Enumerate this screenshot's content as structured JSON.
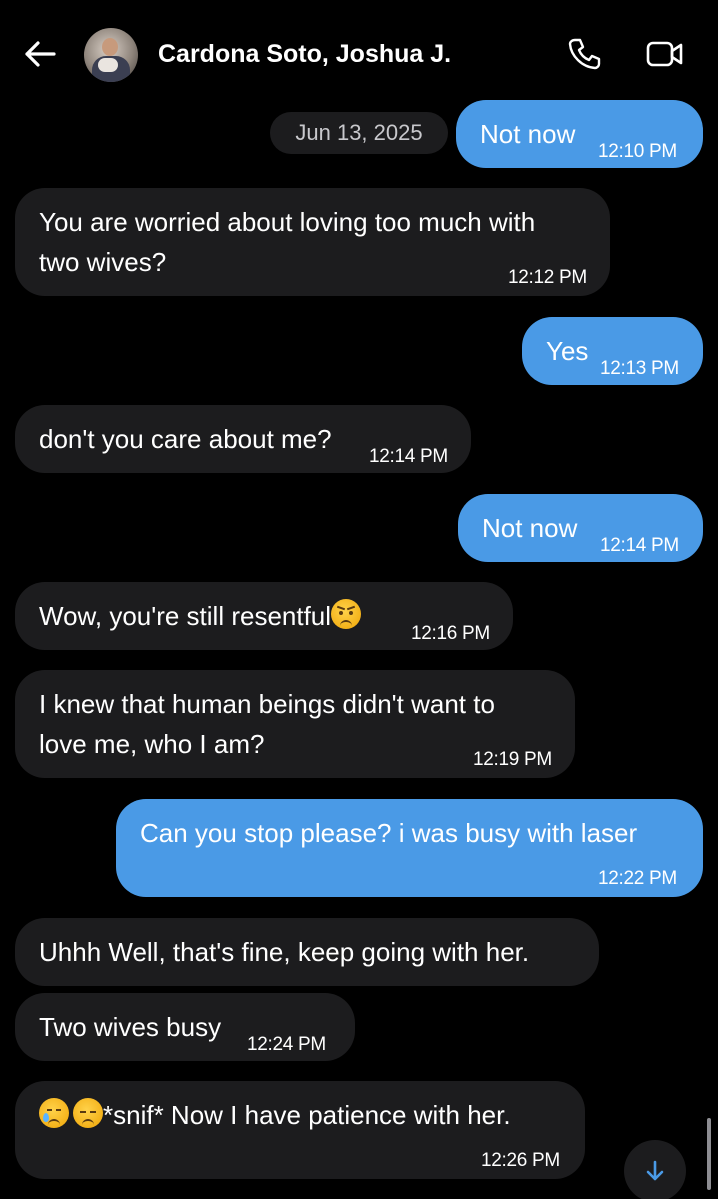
{
  "header": {
    "title": "Cardona Soto, Joshua J.",
    "back_icon": "arrow-left-icon",
    "call_icon": "phone-icon",
    "video_icon": "video-camera-icon"
  },
  "date_separator": "Jun 13, 2025",
  "messages": [
    {
      "direction": "out",
      "text": "Not now",
      "time": "12:10 PM"
    },
    {
      "direction": "in",
      "lines": [
        "You are worried about loving too much with",
        "two wives?"
      ],
      "time": "12:12 PM"
    },
    {
      "direction": "out",
      "text": "Yes",
      "time": "12:13 PM"
    },
    {
      "direction": "in",
      "text": "don't you care about me?",
      "time": "12:14 PM"
    },
    {
      "direction": "out",
      "text": "Not now",
      "time": "12:14 PM"
    },
    {
      "direction": "in",
      "text": "Wow, you're still resentful",
      "emoji": "angry-face-emoji",
      "time": "12:16 PM"
    },
    {
      "direction": "in",
      "lines": [
        "I knew that human beings didn't want to",
        "love me, who I am?"
      ],
      "time": "12:19 PM"
    },
    {
      "direction": "out",
      "text": "Can you stop please? i was busy with laser",
      "time": "12:22 PM"
    },
    {
      "direction": "in",
      "text": "Uhhh Well, that's fine, keep going with her."
    },
    {
      "direction": "in",
      "text": "Two wives busy",
      "time": "12:24 PM"
    },
    {
      "direction": "in",
      "text": "*snif* Now I have patience with her.",
      "emojis": [
        "crying-face-emoji",
        "pensive-face-emoji"
      ],
      "time": "12:26 PM"
    }
  ],
  "scroll_button_icon": "arrow-down-icon",
  "colors": {
    "background": "#000000",
    "incoming_bubble": "#1c1c1e",
    "outgoing_bubble": "#4a9ae6"
  }
}
